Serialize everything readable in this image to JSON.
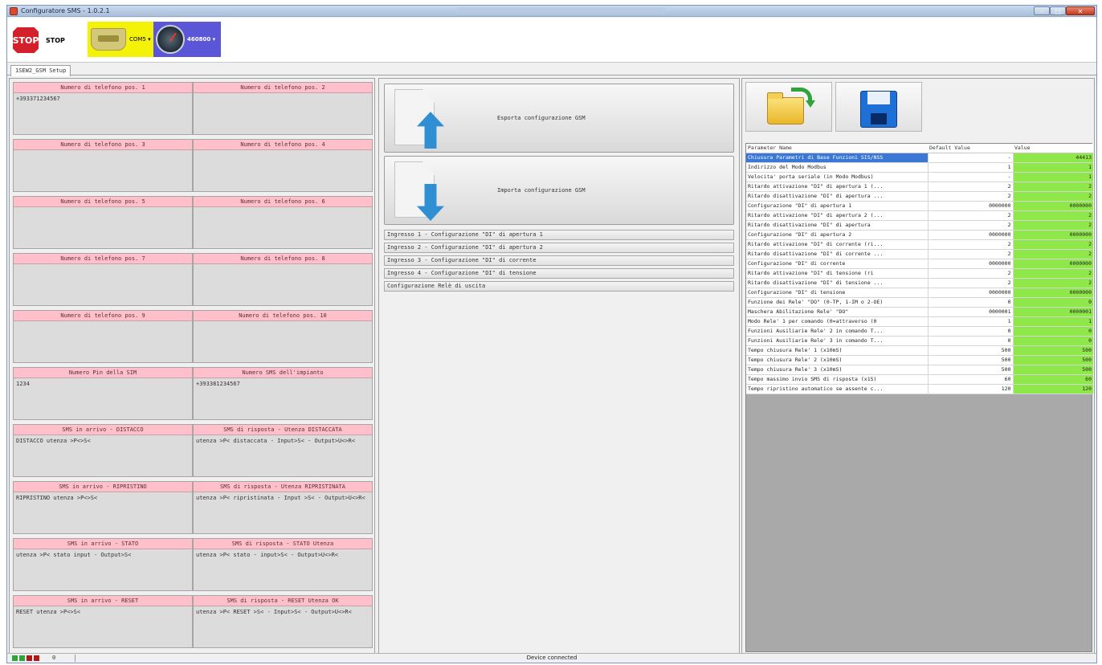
{
  "window": {
    "title": "Configuratore SMS - 1.0.2.1"
  },
  "toolbar": {
    "stop_icon_text": "STOP",
    "stop_label": "STOP",
    "port_label": "COM5",
    "baud_label": "460800"
  },
  "tab": {
    "label": "1SEW2_GSM Setup"
  },
  "fields": [
    {
      "header": "Numero di telefono pos. 1",
      "value": "+393371234567"
    },
    {
      "header": "Numero di telefono pos. 2",
      "value": ""
    },
    {
      "header": "Numero di telefono pos. 3",
      "value": ""
    },
    {
      "header": "Numero di telefono pos. 4",
      "value": ""
    },
    {
      "header": "Numero di telefono pos. 5",
      "value": ""
    },
    {
      "header": "Numero di telefono pos. 6",
      "value": ""
    },
    {
      "header": "Numero di telefono pos. 7",
      "value": ""
    },
    {
      "header": "Numero di telefono pos. 8",
      "value": ""
    },
    {
      "header": "Numero di telefono pos. 9",
      "value": ""
    },
    {
      "header": "Numero di telefono pos. 10",
      "value": ""
    },
    {
      "header": "Numero Pin della SIM",
      "value": "1234"
    },
    {
      "header": "Numero SMS dell'impianto",
      "value": "+393381234567"
    },
    {
      "header": "SMS in arrivo - DISTACCO",
      "value": "DISTACCO utenza >P<>S<"
    },
    {
      "header": "SMS di risposta - Utenza DISTACCATA",
      "value": "utenza >P< distaccata - Input>S< - Output>U<>R<"
    },
    {
      "header": "SMS in arrivo - RIPRISTINO",
      "value": "RIPRISTINO utenza >P<>S<"
    },
    {
      "header": "SMS di risposta - Utenza RIPRISTINATA",
      "value": "utenza >P< ripristinata - Input >S< - Output>U<>R<"
    },
    {
      "header": "SMS in arrivo - STATO",
      "value": "utenza >P< stato input - Output>S<"
    },
    {
      "header": "SMS di risposta - STATO Utenza",
      "value": "utenza >P< stato - input>S< - Output>U<>R<"
    },
    {
      "header": "SMS in arrivo - RESET",
      "value": "RESET utenza >P<>S<"
    },
    {
      "header": "SMS di risposta - RESET Utenza OK",
      "value": "utenza >P< RESET >S< - Input>S< - Output>U<>R<"
    }
  ],
  "mid": {
    "export_label": "Esporta configurazione GSM",
    "import_label": "Importa configurazione GSM",
    "items": [
      "Ingresso 1 - Configurazione \"DI\" di apertura 1",
      "Ingresso 2 - Configurazione \"DI\" di apertura 2",
      "Ingresso 3 - Configurazione \"DI\" di corrente",
      "Ingresso 4 - Configurazione \"DI\" di tensione",
      "Configurazione Relè di uscita"
    ]
  },
  "params": {
    "headers": {
      "name": "Parameter Name",
      "default": "Default Value",
      "value": "Value"
    },
    "rows": [
      {
        "name": "Chiusura Parametri di Base Funzioni SIS/NSS",
        "default": "-",
        "value": "44413"
      },
      {
        "name": "Indirizzo del Modo Modbus",
        "default": "1",
        "value": "1"
      },
      {
        "name": "Velocita' porta seriale (in Modo Modbus)",
        "default": "-",
        "value": "1"
      },
      {
        "name": "Ritardo attivazione \"DI\" di apertura 1 (...",
        "default": "2",
        "value": "2"
      },
      {
        "name": "Ritardo disattivazione \"DI\" di apertura ...",
        "default": "2",
        "value": "2"
      },
      {
        "name": "Configurazione \"DI\" di apertura 1",
        "default": "0000000",
        "value": "0000000"
      },
      {
        "name": "Ritardo attivazione \"DI\" di apertura 2 (...",
        "default": "2",
        "value": "2"
      },
      {
        "name": "Ritardo disattivazione \"DI\" di apertura",
        "default": "2",
        "value": "2"
      },
      {
        "name": "Configurazione \"DI\" di apertura 2",
        "default": "0000000",
        "value": "0000000"
      },
      {
        "name": "Ritardo attivazione \"DI\" di corrente (ri...",
        "default": "2",
        "value": "2"
      },
      {
        "name": "Ritardo disattivazione \"DI\" di corrente ...",
        "default": "2",
        "value": "2"
      },
      {
        "name": "Configurazione \"DI\" di corrente",
        "default": "0000000",
        "value": "0000000"
      },
      {
        "name": "Ritardo attivazione \"DI\" di tensione (ri",
        "default": "2",
        "value": "2"
      },
      {
        "name": "Ritardo disattivazione \"DI\" di tensione ...",
        "default": "2",
        "value": "2"
      },
      {
        "name": "Configurazione \"DI\" di tensione",
        "default": "0000000",
        "value": "0000000"
      },
      {
        "name": "Funzione dei Rele' \"DO\" (0-TP, 1-IM o 2-OE)",
        "default": "0",
        "value": "0"
      },
      {
        "name": "Maschera Abilitazione Rele' \"DO\"",
        "default": "0000001",
        "value": "0000001"
      },
      {
        "name": "Modo Rele' 1 per comando (0=attraverso (0",
        "default": "1",
        "value": "1"
      },
      {
        "name": "Funzioni Ausiliarie Rele' 2 in comando T...",
        "default": "0",
        "value": "0"
      },
      {
        "name": "Funzioni Ausiliarie Rele' 3 in comando T...",
        "default": "0",
        "value": "0"
      },
      {
        "name": "Tempo chiusura Rele' 1 (x10mS)",
        "default": "500",
        "value": "500"
      },
      {
        "name": "Tempo chiusura Rele' 2 (x10mS)",
        "default": "500",
        "value": "500"
      },
      {
        "name": "Tempo chiusura Rele' 3 (x10mS)",
        "default": "500",
        "value": "500"
      },
      {
        "name": "Tempo massimo invio SMS di risposta (x1S)",
        "default": "60",
        "value": "60"
      },
      {
        "name": "Tempo ripristino automatico se assente c...",
        "default": "120",
        "value": "120"
      }
    ]
  },
  "status": {
    "count": "0",
    "text": "Device connected"
  },
  "colors": {
    "field_header": "#ffc0cb",
    "value_cell": "#8ee84a",
    "selected_row": "#3a78d6",
    "stop_red": "#d4202a",
    "port_yellow": "#f5f20a",
    "baud_blue": "#5b56d8"
  }
}
